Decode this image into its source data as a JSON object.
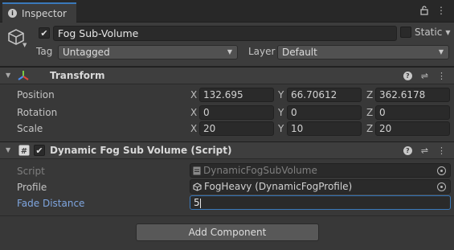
{
  "tab": {
    "title": "Inspector"
  },
  "header": {
    "object_name": "Fog Sub-Volume",
    "static_label": "Static",
    "tag_label": "Tag",
    "tag_value": "Untagged",
    "layer_label": "Layer",
    "layer_value": "Default"
  },
  "transform": {
    "title": "Transform",
    "rows": [
      {
        "label": "Position",
        "x": "132.695",
        "y": "66.70612",
        "z": "362.6178"
      },
      {
        "label": "Rotation",
        "x": "0",
        "y": "0",
        "z": "0"
      },
      {
        "label": "Scale",
        "x": "20",
        "y": "10",
        "z": "20"
      }
    ],
    "axis_labels": {
      "x": "X",
      "y": "Y",
      "z": "Z"
    }
  },
  "script_component": {
    "title": "Dynamic Fog Sub Volume (Script)",
    "script_label": "Script",
    "script_value": "DynamicFogSubVolume",
    "profile_label": "Profile",
    "profile_value": "FogHeavy (DynamicFogProfile)",
    "fade_label": "Fade Distance",
    "fade_value": "5"
  },
  "add_component_label": "Add Component",
  "colors": {
    "accent": "#3a79bb",
    "fade_label": "#7fa6e0",
    "background": "#383838"
  }
}
